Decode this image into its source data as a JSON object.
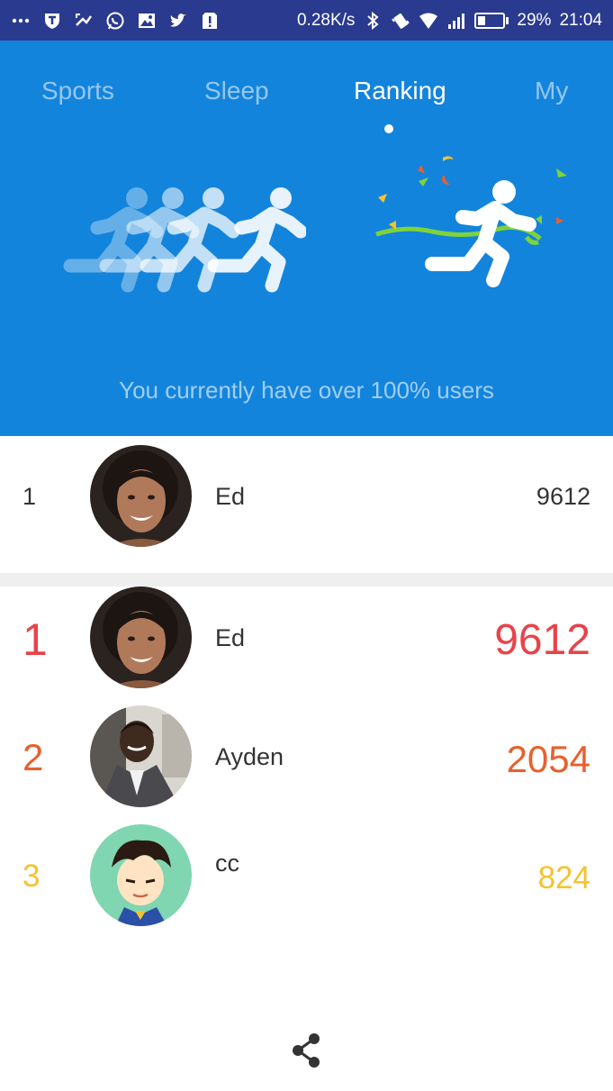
{
  "status_bar": {
    "speed": "0.28K/s",
    "battery": "29%",
    "battery_level": 0.29,
    "time": "21:04",
    "icons": [
      "more-icon",
      "vpn-icon",
      "missed-call-icon",
      "whatsapp-icon",
      "image-icon",
      "twitter-icon",
      "alert-icon",
      "bluetooth-icon",
      "vibrate-icon",
      "wifi-icon",
      "signal-icon",
      "battery-icon"
    ]
  },
  "tabs": [
    {
      "label": "Sports",
      "active": false
    },
    {
      "label": "Sleep",
      "active": false
    },
    {
      "label": "Ranking",
      "active": true
    },
    {
      "label": "My",
      "active": false
    }
  ],
  "header": {
    "message": "You currently have over 100% users",
    "color": "#1384dc"
  },
  "my_rank": {
    "rank": "1",
    "name": "Ed",
    "steps": "9612"
  },
  "ranking": [
    {
      "rank": "1",
      "name": "Ed",
      "steps": "9612",
      "color": "#e8434a"
    },
    {
      "rank": "2",
      "name": "Ayden",
      "steps": "2054",
      "color": "#e8602f"
    },
    {
      "rank": "3",
      "name": "cc",
      "steps": "824",
      "color": "#f5c22f"
    }
  ],
  "footer": {
    "icon": "share-icon"
  }
}
